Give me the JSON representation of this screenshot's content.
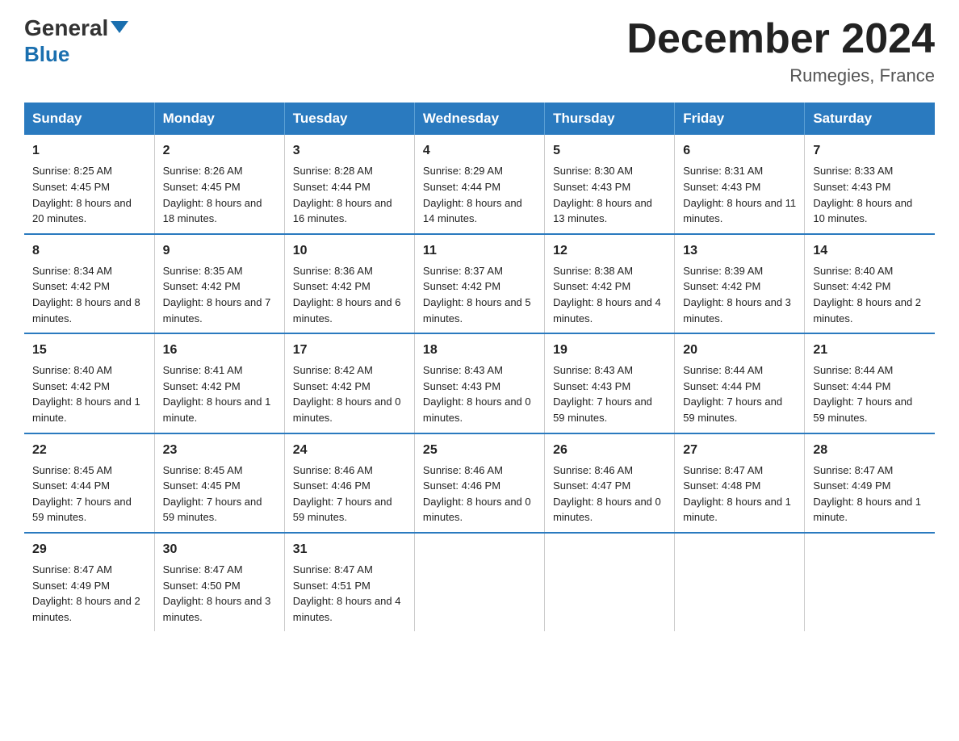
{
  "header": {
    "logo_general": "General",
    "logo_blue": "Blue",
    "month_title": "December 2024",
    "location": "Rumegies, France"
  },
  "days_of_week": [
    "Sunday",
    "Monday",
    "Tuesday",
    "Wednesday",
    "Thursday",
    "Friday",
    "Saturday"
  ],
  "weeks": [
    [
      {
        "day": "1",
        "sunrise": "Sunrise: 8:25 AM",
        "sunset": "Sunset: 4:45 PM",
        "daylight": "Daylight: 8 hours and 20 minutes."
      },
      {
        "day": "2",
        "sunrise": "Sunrise: 8:26 AM",
        "sunset": "Sunset: 4:45 PM",
        "daylight": "Daylight: 8 hours and 18 minutes."
      },
      {
        "day": "3",
        "sunrise": "Sunrise: 8:28 AM",
        "sunset": "Sunset: 4:44 PM",
        "daylight": "Daylight: 8 hours and 16 minutes."
      },
      {
        "day": "4",
        "sunrise": "Sunrise: 8:29 AM",
        "sunset": "Sunset: 4:44 PM",
        "daylight": "Daylight: 8 hours and 14 minutes."
      },
      {
        "day": "5",
        "sunrise": "Sunrise: 8:30 AM",
        "sunset": "Sunset: 4:43 PM",
        "daylight": "Daylight: 8 hours and 13 minutes."
      },
      {
        "day": "6",
        "sunrise": "Sunrise: 8:31 AM",
        "sunset": "Sunset: 4:43 PM",
        "daylight": "Daylight: 8 hours and 11 minutes."
      },
      {
        "day": "7",
        "sunrise": "Sunrise: 8:33 AM",
        "sunset": "Sunset: 4:43 PM",
        "daylight": "Daylight: 8 hours and 10 minutes."
      }
    ],
    [
      {
        "day": "8",
        "sunrise": "Sunrise: 8:34 AM",
        "sunset": "Sunset: 4:42 PM",
        "daylight": "Daylight: 8 hours and 8 minutes."
      },
      {
        "day": "9",
        "sunrise": "Sunrise: 8:35 AM",
        "sunset": "Sunset: 4:42 PM",
        "daylight": "Daylight: 8 hours and 7 minutes."
      },
      {
        "day": "10",
        "sunrise": "Sunrise: 8:36 AM",
        "sunset": "Sunset: 4:42 PM",
        "daylight": "Daylight: 8 hours and 6 minutes."
      },
      {
        "day": "11",
        "sunrise": "Sunrise: 8:37 AM",
        "sunset": "Sunset: 4:42 PM",
        "daylight": "Daylight: 8 hours and 5 minutes."
      },
      {
        "day": "12",
        "sunrise": "Sunrise: 8:38 AM",
        "sunset": "Sunset: 4:42 PM",
        "daylight": "Daylight: 8 hours and 4 minutes."
      },
      {
        "day": "13",
        "sunrise": "Sunrise: 8:39 AM",
        "sunset": "Sunset: 4:42 PM",
        "daylight": "Daylight: 8 hours and 3 minutes."
      },
      {
        "day": "14",
        "sunrise": "Sunrise: 8:40 AM",
        "sunset": "Sunset: 4:42 PM",
        "daylight": "Daylight: 8 hours and 2 minutes."
      }
    ],
    [
      {
        "day": "15",
        "sunrise": "Sunrise: 8:40 AM",
        "sunset": "Sunset: 4:42 PM",
        "daylight": "Daylight: 8 hours and 1 minute."
      },
      {
        "day": "16",
        "sunrise": "Sunrise: 8:41 AM",
        "sunset": "Sunset: 4:42 PM",
        "daylight": "Daylight: 8 hours and 1 minute."
      },
      {
        "day": "17",
        "sunrise": "Sunrise: 8:42 AM",
        "sunset": "Sunset: 4:42 PM",
        "daylight": "Daylight: 8 hours and 0 minutes."
      },
      {
        "day": "18",
        "sunrise": "Sunrise: 8:43 AM",
        "sunset": "Sunset: 4:43 PM",
        "daylight": "Daylight: 8 hours and 0 minutes."
      },
      {
        "day": "19",
        "sunrise": "Sunrise: 8:43 AM",
        "sunset": "Sunset: 4:43 PM",
        "daylight": "Daylight: 7 hours and 59 minutes."
      },
      {
        "day": "20",
        "sunrise": "Sunrise: 8:44 AM",
        "sunset": "Sunset: 4:44 PM",
        "daylight": "Daylight: 7 hours and 59 minutes."
      },
      {
        "day": "21",
        "sunrise": "Sunrise: 8:44 AM",
        "sunset": "Sunset: 4:44 PM",
        "daylight": "Daylight: 7 hours and 59 minutes."
      }
    ],
    [
      {
        "day": "22",
        "sunrise": "Sunrise: 8:45 AM",
        "sunset": "Sunset: 4:44 PM",
        "daylight": "Daylight: 7 hours and 59 minutes."
      },
      {
        "day": "23",
        "sunrise": "Sunrise: 8:45 AM",
        "sunset": "Sunset: 4:45 PM",
        "daylight": "Daylight: 7 hours and 59 minutes."
      },
      {
        "day": "24",
        "sunrise": "Sunrise: 8:46 AM",
        "sunset": "Sunset: 4:46 PM",
        "daylight": "Daylight: 7 hours and 59 minutes."
      },
      {
        "day": "25",
        "sunrise": "Sunrise: 8:46 AM",
        "sunset": "Sunset: 4:46 PM",
        "daylight": "Daylight: 8 hours and 0 minutes."
      },
      {
        "day": "26",
        "sunrise": "Sunrise: 8:46 AM",
        "sunset": "Sunset: 4:47 PM",
        "daylight": "Daylight: 8 hours and 0 minutes."
      },
      {
        "day": "27",
        "sunrise": "Sunrise: 8:47 AM",
        "sunset": "Sunset: 4:48 PM",
        "daylight": "Daylight: 8 hours and 1 minute."
      },
      {
        "day": "28",
        "sunrise": "Sunrise: 8:47 AM",
        "sunset": "Sunset: 4:49 PM",
        "daylight": "Daylight: 8 hours and 1 minute."
      }
    ],
    [
      {
        "day": "29",
        "sunrise": "Sunrise: 8:47 AM",
        "sunset": "Sunset: 4:49 PM",
        "daylight": "Daylight: 8 hours and 2 minutes."
      },
      {
        "day": "30",
        "sunrise": "Sunrise: 8:47 AM",
        "sunset": "Sunset: 4:50 PM",
        "daylight": "Daylight: 8 hours and 3 minutes."
      },
      {
        "day": "31",
        "sunrise": "Sunrise: 8:47 AM",
        "sunset": "Sunset: 4:51 PM",
        "daylight": "Daylight: 8 hours and 4 minutes."
      },
      {
        "day": "",
        "sunrise": "",
        "sunset": "",
        "daylight": ""
      },
      {
        "day": "",
        "sunrise": "",
        "sunset": "",
        "daylight": ""
      },
      {
        "day": "",
        "sunrise": "",
        "sunset": "",
        "daylight": ""
      },
      {
        "day": "",
        "sunrise": "",
        "sunset": "",
        "daylight": ""
      }
    ]
  ]
}
